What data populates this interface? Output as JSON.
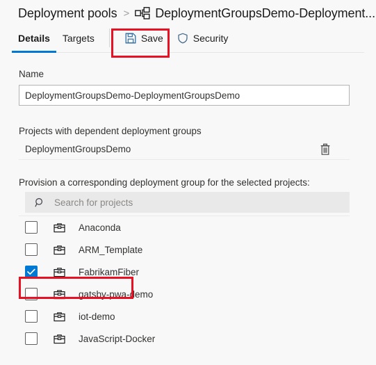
{
  "breadcrumb": {
    "parent": "Deployment pools",
    "separator": ">",
    "icon": "deployment-group-icon",
    "current": "DeploymentGroupsDemo-Deployment..."
  },
  "commandbar": {
    "tabs": [
      {
        "label": "Details",
        "active": true
      },
      {
        "label": "Targets",
        "active": false
      }
    ],
    "actions": [
      {
        "label": "Save",
        "icon": "save-icon"
      },
      {
        "label": "Security",
        "icon": "shield-icon"
      }
    ]
  },
  "form": {
    "name_label": "Name",
    "name_value": "DeploymentGroupsDemo-DeploymentGroupsDemo",
    "name_placeholder": "",
    "dependent_label": "Projects with dependent deployment groups",
    "dependent_projects": [
      {
        "name": "DeploymentGroupsDemo",
        "delete_icon": "trash-icon"
      }
    ],
    "provision_label": "Provision a corresponding deployment group for the selected projects:",
    "search": {
      "icon": "search-icon",
      "placeholder": "Search for projects",
      "value": ""
    },
    "projects": [
      {
        "name": "Anaconda",
        "checked": false,
        "icon": "project-briefcase-icon"
      },
      {
        "name": "ARM_Template",
        "checked": false,
        "icon": "project-briefcase-icon"
      },
      {
        "name": "FabrikamFiber",
        "checked": true,
        "icon": "project-briefcase-icon"
      },
      {
        "name": "gatsby-pwa-demo",
        "checked": false,
        "icon": "project-briefcase-icon"
      },
      {
        "name": "iot-demo",
        "checked": false,
        "icon": "project-briefcase-icon"
      },
      {
        "name": "JavaScript-Docker",
        "checked": false,
        "icon": "project-briefcase-icon"
      }
    ]
  },
  "annotations": [
    {
      "target": "save-button",
      "color": "#e81123"
    },
    {
      "target": "project-row-fabrikamfiber",
      "color": "#e81123"
    }
  ],
  "colors": {
    "accent": "#0078d4",
    "annotation": "#e81123",
    "page_bg": "#f8f8f8",
    "search_bg": "#e9e9e9"
  }
}
